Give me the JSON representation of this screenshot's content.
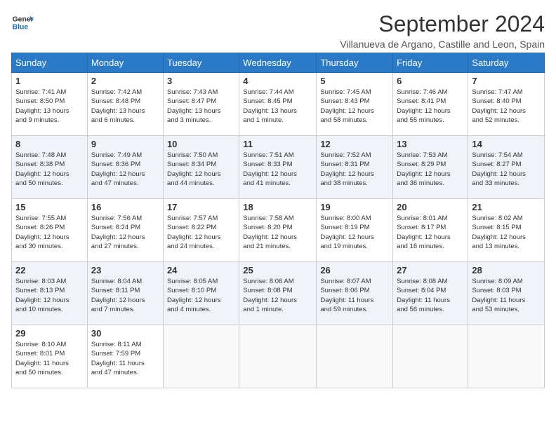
{
  "header": {
    "logo_line1": "General",
    "logo_line2": "Blue",
    "month_title": "September 2024",
    "subtitle": "Villanueva de Argano, Castille and Leon, Spain"
  },
  "weekdays": [
    "Sunday",
    "Monday",
    "Tuesday",
    "Wednesday",
    "Thursday",
    "Friday",
    "Saturday"
  ],
  "weeks": [
    [
      {
        "day": "1",
        "info": "Sunrise: 7:41 AM\nSunset: 8:50 PM\nDaylight: 13 hours\nand 9 minutes."
      },
      {
        "day": "2",
        "info": "Sunrise: 7:42 AM\nSunset: 8:48 PM\nDaylight: 13 hours\nand 6 minutes."
      },
      {
        "day": "3",
        "info": "Sunrise: 7:43 AM\nSunset: 8:47 PM\nDaylight: 13 hours\nand 3 minutes."
      },
      {
        "day": "4",
        "info": "Sunrise: 7:44 AM\nSunset: 8:45 PM\nDaylight: 13 hours\nand 1 minute."
      },
      {
        "day": "5",
        "info": "Sunrise: 7:45 AM\nSunset: 8:43 PM\nDaylight: 12 hours\nand 58 minutes."
      },
      {
        "day": "6",
        "info": "Sunrise: 7:46 AM\nSunset: 8:41 PM\nDaylight: 12 hours\nand 55 minutes."
      },
      {
        "day": "7",
        "info": "Sunrise: 7:47 AM\nSunset: 8:40 PM\nDaylight: 12 hours\nand 52 minutes."
      }
    ],
    [
      {
        "day": "8",
        "info": "Sunrise: 7:48 AM\nSunset: 8:38 PM\nDaylight: 12 hours\nand 50 minutes."
      },
      {
        "day": "9",
        "info": "Sunrise: 7:49 AM\nSunset: 8:36 PM\nDaylight: 12 hours\nand 47 minutes."
      },
      {
        "day": "10",
        "info": "Sunrise: 7:50 AM\nSunset: 8:34 PM\nDaylight: 12 hours\nand 44 minutes."
      },
      {
        "day": "11",
        "info": "Sunrise: 7:51 AM\nSunset: 8:33 PM\nDaylight: 12 hours\nand 41 minutes."
      },
      {
        "day": "12",
        "info": "Sunrise: 7:52 AM\nSunset: 8:31 PM\nDaylight: 12 hours\nand 38 minutes."
      },
      {
        "day": "13",
        "info": "Sunrise: 7:53 AM\nSunset: 8:29 PM\nDaylight: 12 hours\nand 36 minutes."
      },
      {
        "day": "14",
        "info": "Sunrise: 7:54 AM\nSunset: 8:27 PM\nDaylight: 12 hours\nand 33 minutes."
      }
    ],
    [
      {
        "day": "15",
        "info": "Sunrise: 7:55 AM\nSunset: 8:26 PM\nDaylight: 12 hours\nand 30 minutes."
      },
      {
        "day": "16",
        "info": "Sunrise: 7:56 AM\nSunset: 8:24 PM\nDaylight: 12 hours\nand 27 minutes."
      },
      {
        "day": "17",
        "info": "Sunrise: 7:57 AM\nSunset: 8:22 PM\nDaylight: 12 hours\nand 24 minutes."
      },
      {
        "day": "18",
        "info": "Sunrise: 7:58 AM\nSunset: 8:20 PM\nDaylight: 12 hours\nand 21 minutes."
      },
      {
        "day": "19",
        "info": "Sunrise: 8:00 AM\nSunset: 8:19 PM\nDaylight: 12 hours\nand 19 minutes."
      },
      {
        "day": "20",
        "info": "Sunrise: 8:01 AM\nSunset: 8:17 PM\nDaylight: 12 hours\nand 16 minutes."
      },
      {
        "day": "21",
        "info": "Sunrise: 8:02 AM\nSunset: 8:15 PM\nDaylight: 12 hours\nand 13 minutes."
      }
    ],
    [
      {
        "day": "22",
        "info": "Sunrise: 8:03 AM\nSunset: 8:13 PM\nDaylight: 12 hours\nand 10 minutes."
      },
      {
        "day": "23",
        "info": "Sunrise: 8:04 AM\nSunset: 8:11 PM\nDaylight: 12 hours\nand 7 minutes."
      },
      {
        "day": "24",
        "info": "Sunrise: 8:05 AM\nSunset: 8:10 PM\nDaylight: 12 hours\nand 4 minutes."
      },
      {
        "day": "25",
        "info": "Sunrise: 8:06 AM\nSunset: 8:08 PM\nDaylight: 12 hours\nand 1 minute."
      },
      {
        "day": "26",
        "info": "Sunrise: 8:07 AM\nSunset: 8:06 PM\nDaylight: 11 hours\nand 59 minutes."
      },
      {
        "day": "27",
        "info": "Sunrise: 8:08 AM\nSunset: 8:04 PM\nDaylight: 11 hours\nand 56 minutes."
      },
      {
        "day": "28",
        "info": "Sunrise: 8:09 AM\nSunset: 8:03 PM\nDaylight: 11 hours\nand 53 minutes."
      }
    ],
    [
      {
        "day": "29",
        "info": "Sunrise: 8:10 AM\nSunset: 8:01 PM\nDaylight: 11 hours\nand 50 minutes."
      },
      {
        "day": "30",
        "info": "Sunrise: 8:11 AM\nSunset: 7:59 PM\nDaylight: 11 hours\nand 47 minutes."
      },
      {
        "day": "",
        "info": ""
      },
      {
        "day": "",
        "info": ""
      },
      {
        "day": "",
        "info": ""
      },
      {
        "day": "",
        "info": ""
      },
      {
        "day": "",
        "info": ""
      }
    ]
  ]
}
